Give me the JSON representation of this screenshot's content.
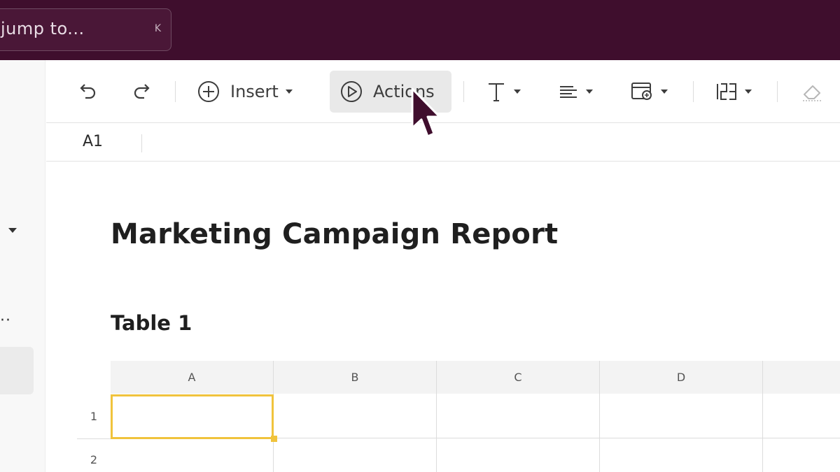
{
  "search": {
    "placeholder": "jump to...",
    "shortcut": "K"
  },
  "toolbar": {
    "insert_label": "Insert",
    "actions_label": "Actions"
  },
  "formula_bar": {
    "cell_reference": "A1"
  },
  "document": {
    "title": "Marketing Campaign Report",
    "table_title": "Table 1"
  },
  "table": {
    "columns": [
      "A",
      "B",
      "C",
      "D"
    ],
    "rows": [
      "1",
      "2"
    ],
    "selected_cell": "A1"
  },
  "colors": {
    "topbar": "#3f0e2d",
    "selection": "#f0c33c"
  },
  "icons": [
    "undo-icon",
    "redo-icon",
    "insert-plus-icon",
    "actions-play-icon",
    "text-format-icon",
    "align-icon",
    "cell-format-icon",
    "number-format-icon",
    "eraser-icon",
    "cursor-pointer"
  ]
}
